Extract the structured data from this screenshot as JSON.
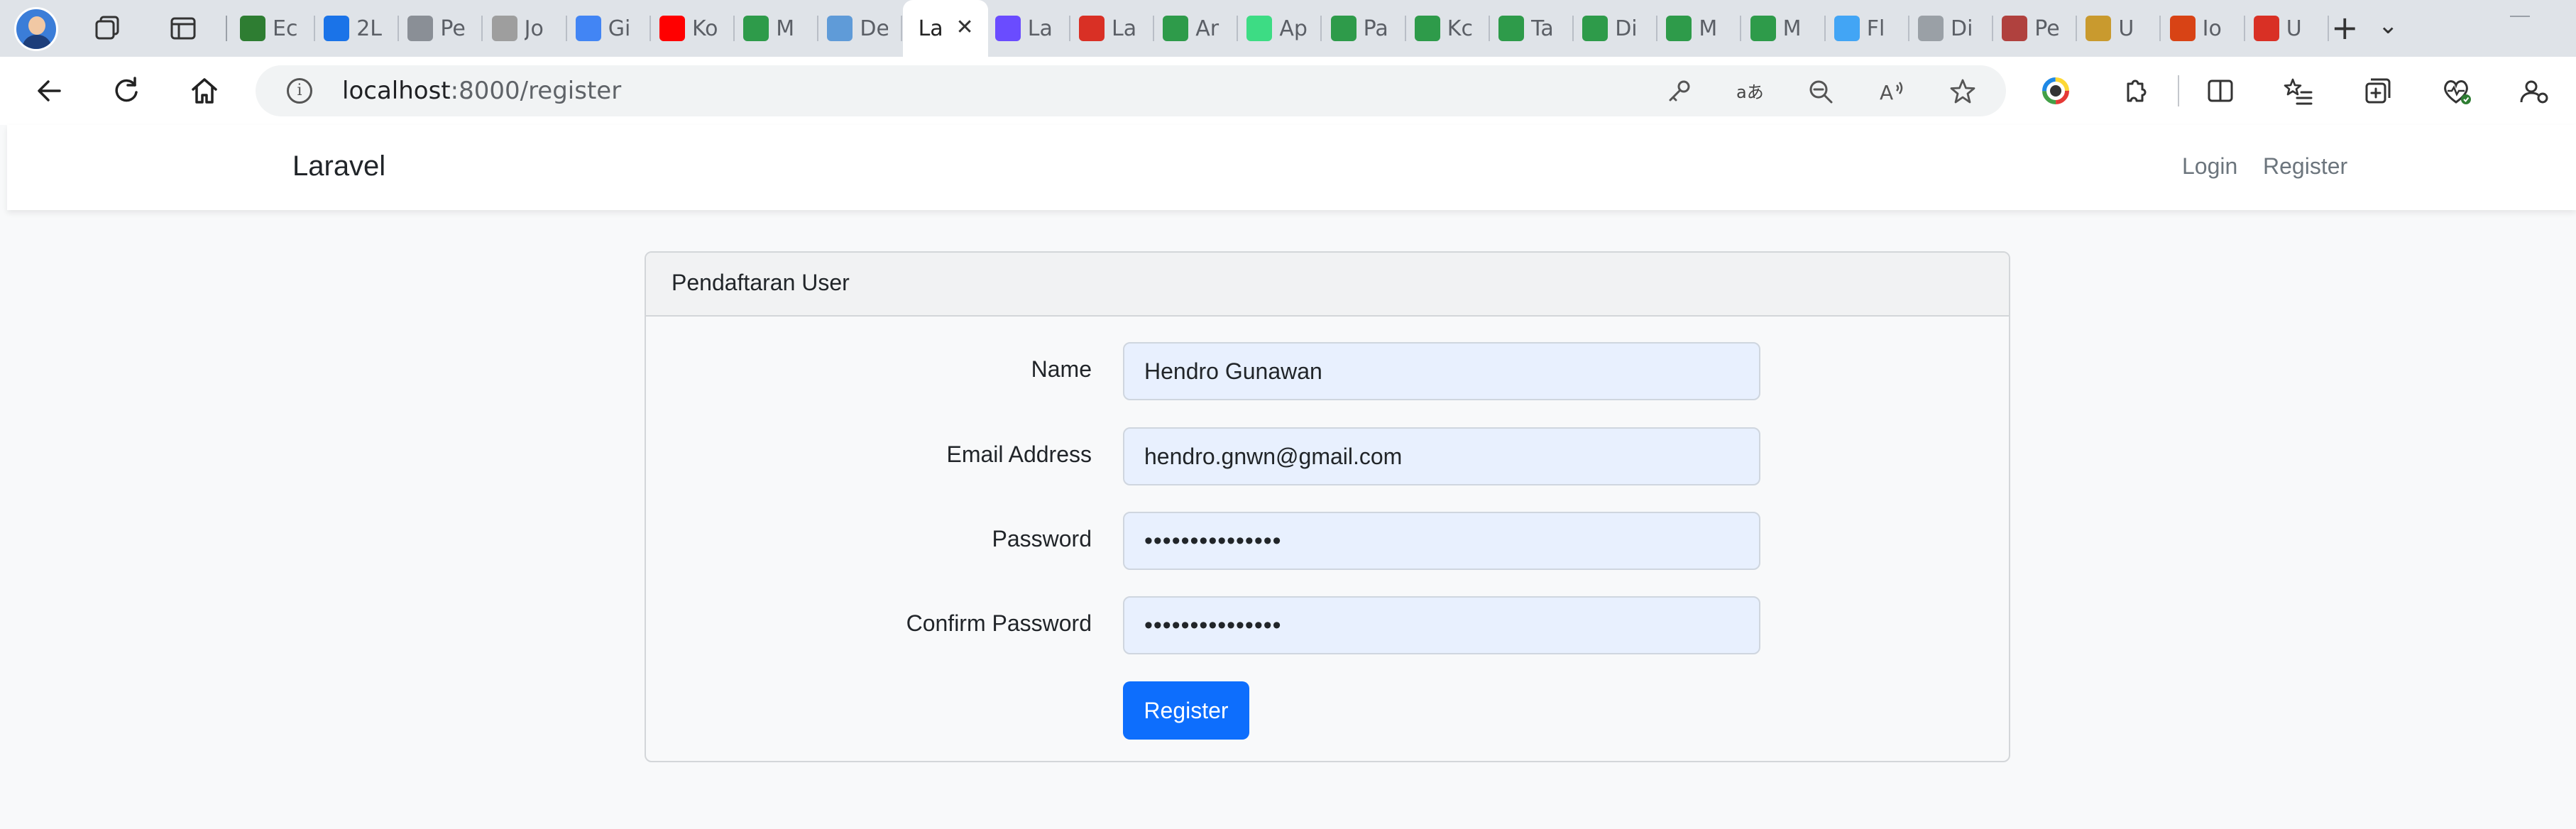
{
  "browser": {
    "tabs": [
      {
        "label": "Ec",
        "icon": "maps-pin-icon",
        "color": "#2e7d32"
      },
      {
        "label": "2L",
        "icon": "google-drive-icon",
        "color": "#1a73e8"
      },
      {
        "label": "Pe",
        "icon": "chatgpt-icon",
        "color": "#8a8f96"
      },
      {
        "label": "Jo",
        "icon": "wikipedia-icon",
        "color": "#9e9e9e"
      },
      {
        "label": "Gi",
        "icon": "translate-icon",
        "color": "#4285f4"
      },
      {
        "label": "Ko",
        "icon": "youtube-icon",
        "color": "#ff0000"
      },
      {
        "label": "M",
        "icon": "mendeley-icon",
        "color": "#2e9b4a"
      },
      {
        "label": "De",
        "icon": "search-icon",
        "color": "#5f9bd8"
      },
      {
        "label": "La",
        "icon": "page-icon",
        "color": "#ffffff",
        "active": true
      },
      {
        "label": "La",
        "icon": "color-wheel-icon",
        "color": "#6a4cff"
      },
      {
        "label": "La",
        "icon": "pdf-icon",
        "color": "#d93025"
      },
      {
        "label": "Ar",
        "icon": "mendeley-icon",
        "color": "#2e9b4a"
      },
      {
        "label": "Ap",
        "icon": "android-icon",
        "color": "#3ddc84"
      },
      {
        "label": "Pa",
        "icon": "mendeley-icon",
        "color": "#2e9b4a"
      },
      {
        "label": "Kc",
        "icon": "mendeley-icon",
        "color": "#2e9b4a"
      },
      {
        "label": "Ta",
        "icon": "mendeley-icon",
        "color": "#2e9b4a"
      },
      {
        "label": "Di",
        "icon": "mendeley-icon",
        "color": "#2e9b4a"
      },
      {
        "label": "M",
        "icon": "mendeley-icon",
        "color": "#2e9b4a"
      },
      {
        "label": "M",
        "icon": "mendeley-icon",
        "color": "#2e9b4a"
      },
      {
        "label": "Fl",
        "icon": "flutter-icon",
        "color": "#42a5f5"
      },
      {
        "label": "Di",
        "icon": "google-icon",
        "color": "#9aa0a6"
      },
      {
        "label": "Pe",
        "icon": "pdf-icon",
        "color": "#b0413e"
      },
      {
        "label": "U",
        "icon": "photo-icon",
        "color": "#c99a2e"
      },
      {
        "label": "Io",
        "icon": "uma-logo-icon",
        "color": "#d84315"
      },
      {
        "label": "U",
        "icon": "pdf-icon",
        "color": "#d93025"
      }
    ],
    "new_tab_symbol": "+",
    "tab_list_symbol": "⌄",
    "address": {
      "host": "localhost",
      "path": ":8000/register"
    }
  },
  "app": {
    "brand": "Laravel",
    "nav": {
      "login": "Login",
      "register": "Register"
    }
  },
  "form": {
    "title": "Pendaftaran User",
    "fields": [
      {
        "label": "Name",
        "value": "Hendro Gunawan"
      },
      {
        "label": "Email Address",
        "value": "hendro.gnwn@gmail.com"
      },
      {
        "label": "Password",
        "value": "•••••••••••••••"
      },
      {
        "label": "Confirm Password",
        "value": "•••••••••••••••"
      }
    ],
    "submit_label": "Register"
  },
  "colors": {
    "primary": "#0d6efd",
    "autofill_bg": "#e8f0fe"
  }
}
